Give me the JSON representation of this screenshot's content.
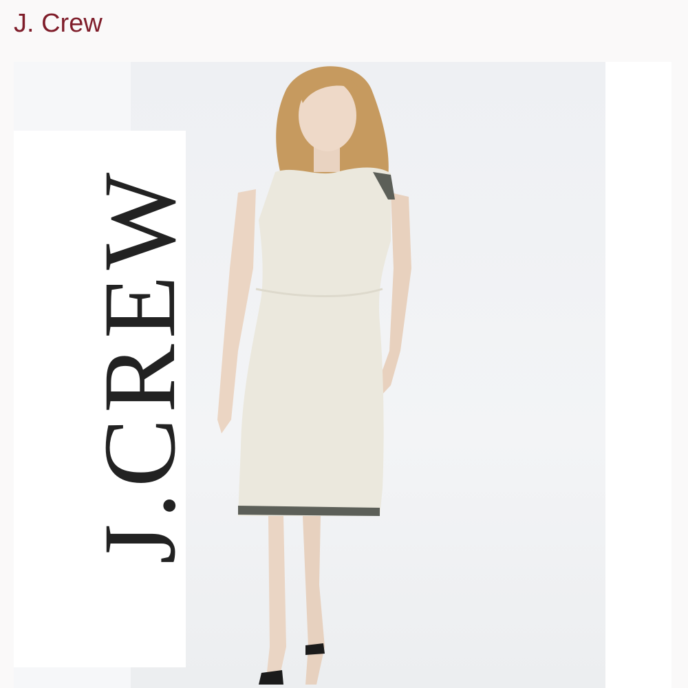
{
  "header": {
    "title": "J. Crew"
  },
  "product_image": {
    "logo_text": "J.CREW",
    "subject": "model-in-sleeveless-tweed-sheath-dress",
    "colors": {
      "brand": "#7f1d2a",
      "dress": "#ebe8dd",
      "trim": "#5c5f58",
      "hair": "#c69a5f"
    }
  }
}
